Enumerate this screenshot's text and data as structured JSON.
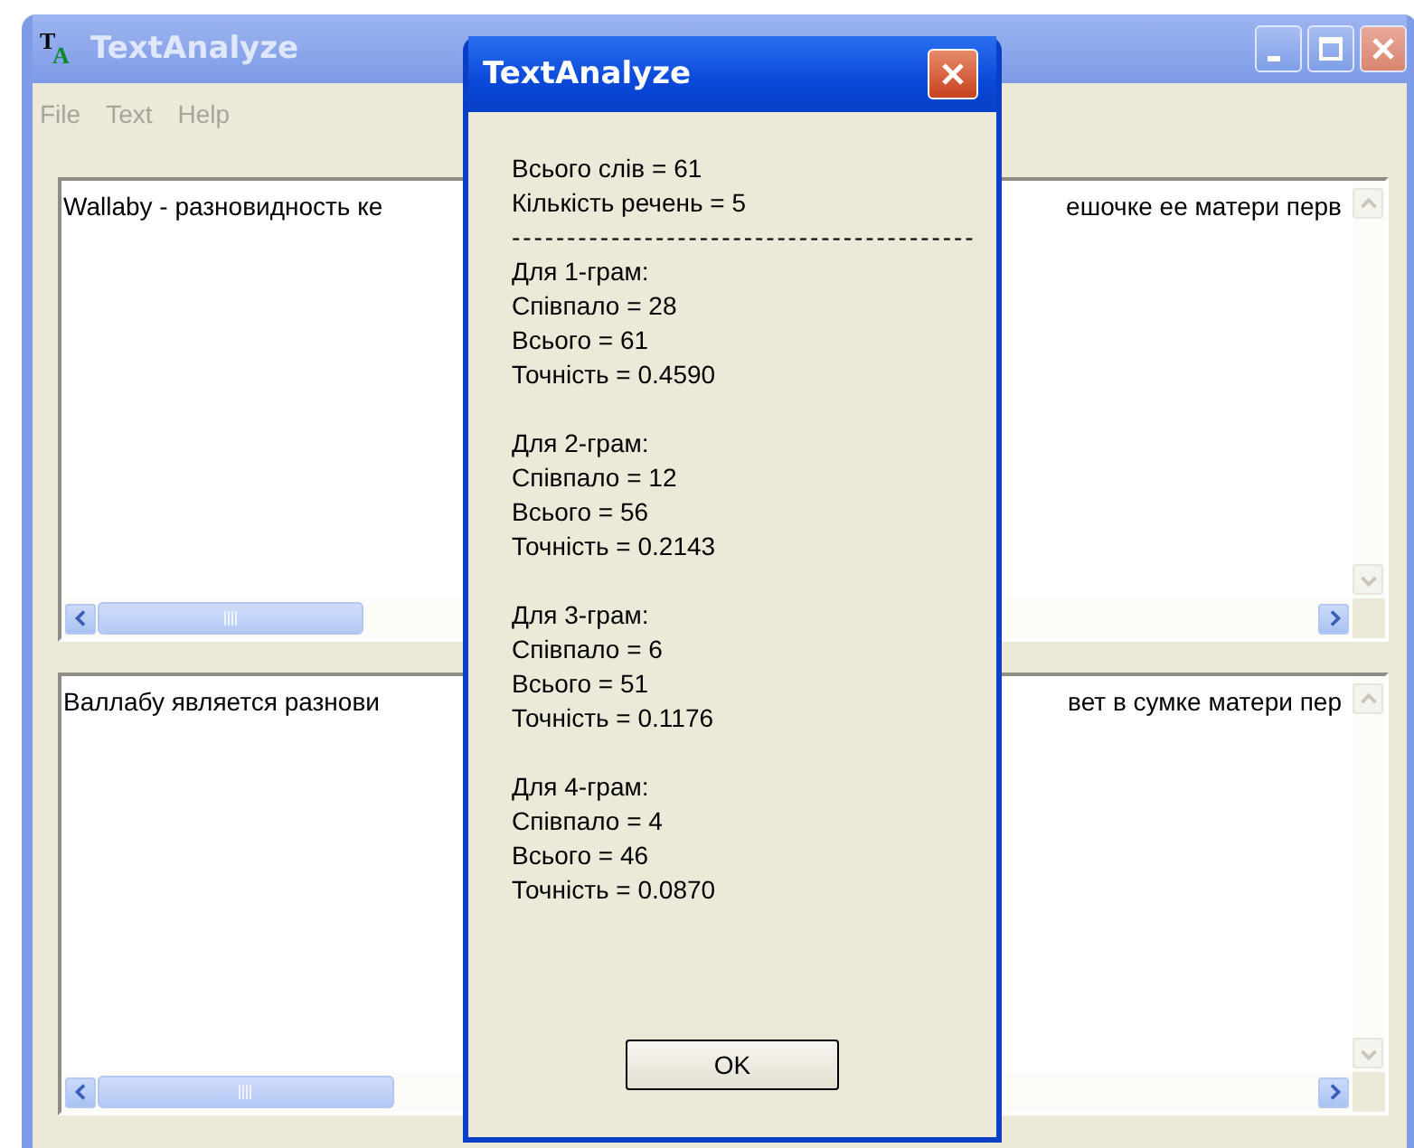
{
  "main_window": {
    "title": "TextAnalyze",
    "icon_letters": [
      "T",
      "A"
    ]
  },
  "menu": [
    {
      "label": "File",
      "disabled": true
    },
    {
      "label": "Text",
      "disabled": true
    },
    {
      "label": "Help",
      "disabled": true
    }
  ],
  "text_panes": [
    {
      "visible_start": "Wallaby - разновидность ке",
      "visible_end": "ешочке ее матери перв"
    },
    {
      "visible_start": "Валлабу является разнови",
      "visible_end": "вет в сумке матери пер"
    }
  ],
  "dialog": {
    "title": "TextAnalyze",
    "summary": [
      "Всього слів = 61",
      "Кількість речень = 5"
    ],
    "separator": "------------------------------------------",
    "groups": [
      {
        "heading": "Для 1-грам:",
        "lines": [
          "Співпало = 28",
          "Всього = 61",
          "Точність = 0.4590"
        ]
      },
      {
        "heading": "Для 2-грам:",
        "lines": [
          "Співпало = 12",
          "Всього = 56",
          "Точність = 0.2143"
        ]
      },
      {
        "heading": "Для 3-грам:",
        "lines": [
          "Співпало = 6",
          "Всього = 51",
          "Точність = 0.1176"
        ]
      },
      {
        "heading": "Для 4-грам:",
        "lines": [
          "Співпало = 4",
          "Всього = 46",
          "Точність = 0.0870"
        ]
      }
    ],
    "button": "OK"
  }
}
